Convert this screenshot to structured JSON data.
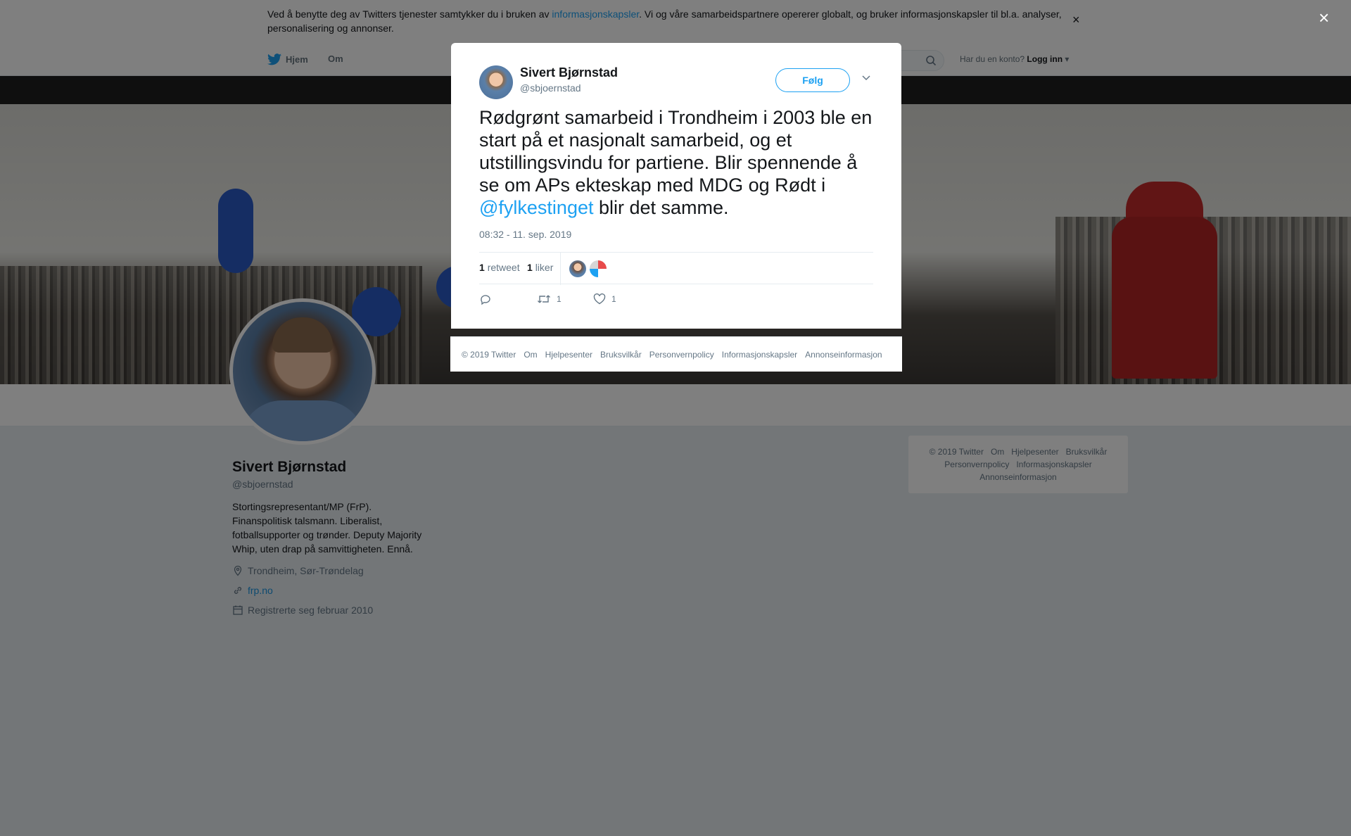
{
  "cookie_bar": {
    "text_before": "Ved å benytte deg av Twitters tjenester samtykker du i bruken av ",
    "link": "informasjonskapsler",
    "text_after": ". Vi og våre samarbeidspartnere opererer globalt, og bruker informasjonskapsler til bl.a. analyser, personalisering og annonser.",
    "close": "×"
  },
  "nav": {
    "home": "Hjem",
    "about": "Om",
    "account_prompt": "Har du en konto?",
    "login": "Logg inn"
  },
  "profile": {
    "name": "Sivert Bjørnstad",
    "handle": "@sbjoernstad",
    "bio": "Stortingsrepresentant/MP (FrP). Finanspolitisk talsmann. Liberalist, fotballsupporter og trønder. Deputy Majority Whip, uten drap på samvittigheten. Ennå.",
    "location": "Trondheim, Sør-Trøndelag",
    "website": "frp.no",
    "joined": "Registrerte seg februar 2010"
  },
  "side_footer": {
    "items": [
      "© 2019 Twitter",
      "Om",
      "Hjelpesenter",
      "Bruksvilkår",
      "Personvernpolicy",
      "Informasjonskapsler",
      "Annonseinformasjon"
    ]
  },
  "overlay": {
    "close": "×"
  },
  "tweet": {
    "author_name": "Sivert Bjørnstad",
    "author_handle": "@sbjoernstad",
    "follow_label": "Følg",
    "text_before": "Rødgrønt samarbeid i Trondheim i 2003 ble en start på et nasjonalt samarbeid, og et utstillingsvindu for partiene. Blir spennende å se om APs ekteskap med MDG og Rødt i ",
    "mention": "@fylkestinget",
    "text_after": " blir det samme.",
    "timestamp": "08:32 - 11. sep. 2019",
    "retweet_count": "1",
    "retweet_label": "retweet",
    "like_count": "1",
    "like_label": "liker",
    "action_retweets": "1",
    "action_likes": "1"
  },
  "modal_footer": {
    "items": [
      "© 2019 Twitter",
      "Om",
      "Hjelpesenter",
      "Bruksvilkår",
      "Personvernpolicy",
      "Informasjonskapsler",
      "Annonseinformasjon"
    ]
  },
  "colors": {
    "twitter_blue": "#1da1f2",
    "overlay": "rgba(0,0,0,0.5)",
    "text_secondary": "#657786"
  }
}
